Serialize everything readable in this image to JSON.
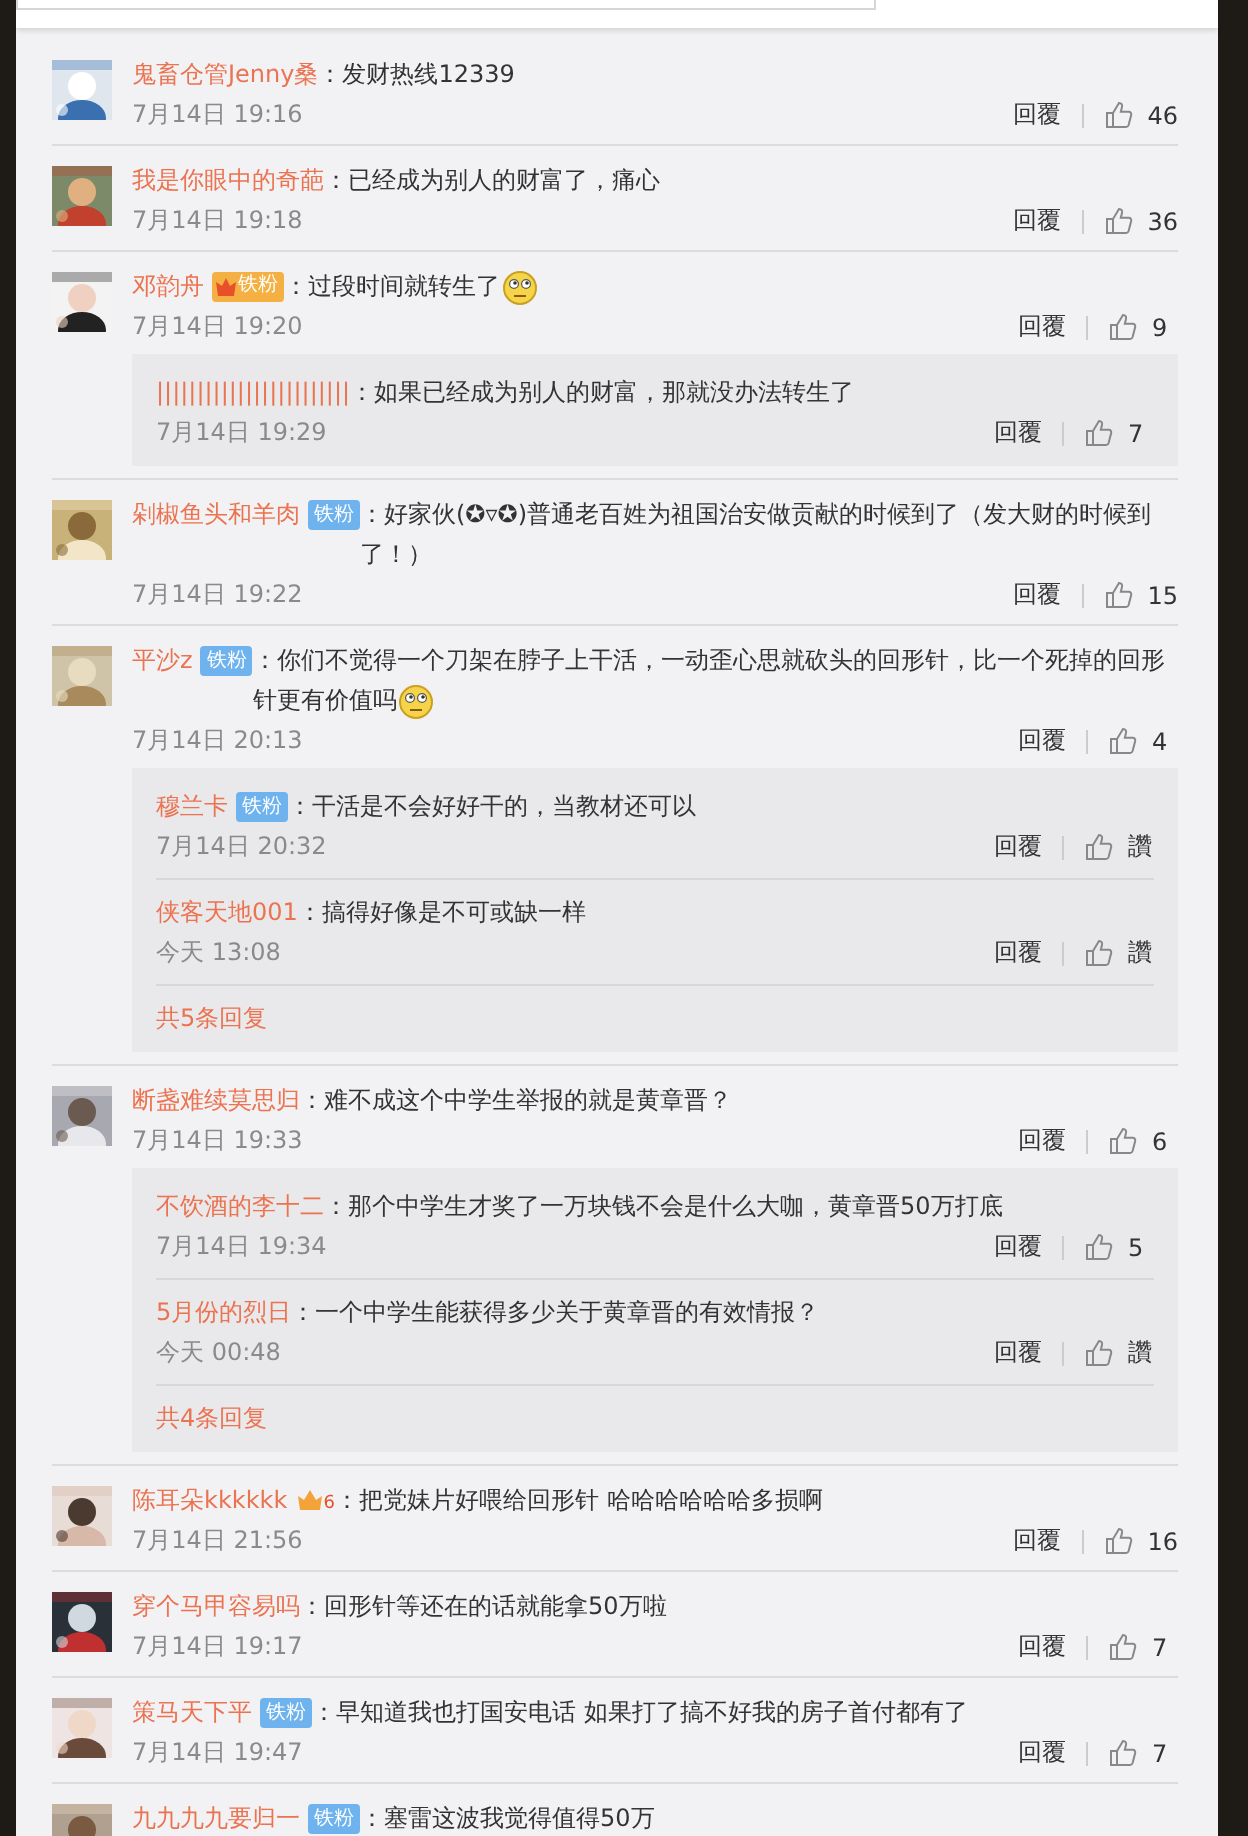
{
  "top_bar": {
    "search_field": {
      "kind": "field"
    }
  },
  "comments": [
    {
      "user": "鬼畜仓管Jenny桑",
      "text": "：发财热线12339",
      "time": "7月14日 19:16",
      "reply": "回覆",
      "likes": "46"
    },
    {
      "user": "我是你眼中的奇葩",
      "text": "：已经成为别人的财富了，痛心",
      "time": "7月14日 19:18",
      "reply": "回覆",
      "likes": "36"
    },
    {
      "user": "邓韵舟",
      "badges": [
        {
          "kind": "vip_fan",
          "label": "铁粉"
        }
      ],
      "text": "：过段时间就转生了",
      "emoticon": true,
      "time": "7月14日 19:20",
      "reply": "回覆",
      "likes": "9",
      "replies": [
        {
          "user": "||||||||||||||||||||||||",
          "text": "：如果已经成为别人的财富，那就没办法转生了",
          "time": "7月14日 19:29",
          "reply": "回覆",
          "likes": "7"
        }
      ]
    },
    {
      "user": "剁椒鱼头和羊肉",
      "badges": [
        {
          "kind": "fan",
          "label": "铁粉"
        }
      ],
      "text": "：好家伙(✪▿✪)普通老百姓为祖国治安做贡献的时候到了（发大财的时候到了！）",
      "time": "7月14日 19:22",
      "reply": "回覆",
      "likes": "15"
    },
    {
      "user": "平沙z",
      "badges": [
        {
          "kind": "fan",
          "label": "铁粉"
        }
      ],
      "text": "：你们不觉得一个刀架在脖子上干活，一动歪心思就砍头的回形针，比一个死掉的回形针更有价值吗",
      "emoticon": true,
      "time": "7月14日 20:13",
      "reply": "回覆",
      "likes": "4",
      "replies": [
        {
          "user": "穆兰卡",
          "badges": [
            {
              "kind": "fan",
              "label": "铁粉"
            }
          ],
          "text": "：干活是不会好好干的，当教材还可以",
          "time": "7月14日 20:32",
          "reply": "回覆",
          "likes": "讚"
        },
        {
          "user": "侠客天地001",
          "text": "：搞得好像是不可或缺一样",
          "time": "今天 13:08",
          "reply": "回覆",
          "likes": "讚"
        }
      ],
      "more": "共5条回复"
    },
    {
      "user": "断盏难续莫思归",
      "text": "：难不成这个中学生举报的就是黄章晋？",
      "time": "7月14日 19:33",
      "reply": "回覆",
      "likes": "6",
      "replies": [
        {
          "user": "不饮酒的李十二",
          "text": "：那个中学生才奖了一万块钱不会是什么大咖，黄章晋50万打底",
          "time": "7月14日 19:34",
          "reply": "回覆",
          "likes": "5"
        },
        {
          "user": "5月份的烈日",
          "text": "：一个中学生能获得多少关于黄章晋的有效情报？",
          "time": "今天 00:48",
          "reply": "回覆",
          "likes": "讚"
        }
      ],
      "more": "共4条回复"
    },
    {
      "user": "陈耳朵kkkkkk",
      "badges": [
        {
          "kind": "vip",
          "label": "6"
        }
      ],
      "text": "：把党妹片好喂给回形针 哈哈哈哈哈哈多损啊",
      "time": "7月14日 21:56",
      "reply": "回覆",
      "likes": "16"
    },
    {
      "user": "穿个马甲容易吗",
      "text": "：回形针等还在的话就能拿50万啦",
      "time": "7月14日 19:17",
      "reply": "回覆",
      "likes": "7"
    },
    {
      "user": "策马天下平",
      "badges": [
        {
          "kind": "fan",
          "label": "铁粉"
        }
      ],
      "text": "：早知道我也打国安电话 如果打了搞不好我的房子首付都有了",
      "time": "7月14日 19:47",
      "reply": "回覆",
      "likes": "7"
    },
    {
      "user": "九九九九要归一",
      "badges": [
        {
          "kind": "fan",
          "label": "铁粉"
        }
      ],
      "text": "：塞雷这波我觉得值得50万"
    }
  ]
}
